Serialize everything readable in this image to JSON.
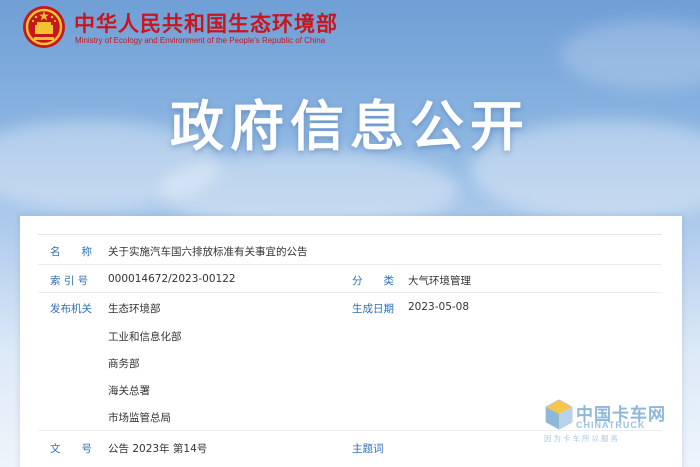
{
  "header": {
    "site_title": "中华人民共和国生态环境部",
    "site_subtitle": "Ministry of Ecology and Environment of the People's Republic of China",
    "emblem_icon": "national-emblem-icon"
  },
  "banner": {
    "title": "政府信息公开"
  },
  "info": {
    "name_label": "名　　称",
    "name_value": "关于实施汽车国六排放标准有关事宜的公告",
    "index_label": "索 引 号",
    "index_value": "000014672/2023-00122",
    "category_label": "分　　类",
    "category_value": "大气环境管理",
    "issuer_label": "发布机关",
    "issuers": [
      "生态环境部",
      "工业和信息化部",
      "商务部",
      "海关总署",
      "市场监管总局"
    ],
    "date_label": "生成日期",
    "date_value": "2023-05-08",
    "doc_no_label": "文　　号",
    "doc_no_value": "公告 2023年 第14号",
    "subject_label": "主题词",
    "subject_value": ""
  },
  "watermark": {
    "text": "中国卡车网",
    "sub": "CHINATRUCK",
    "slogan": "因为卡车所以服务"
  },
  "colors": {
    "brand_red": "#c8161d",
    "label_blue": "#2f6fb5"
  }
}
